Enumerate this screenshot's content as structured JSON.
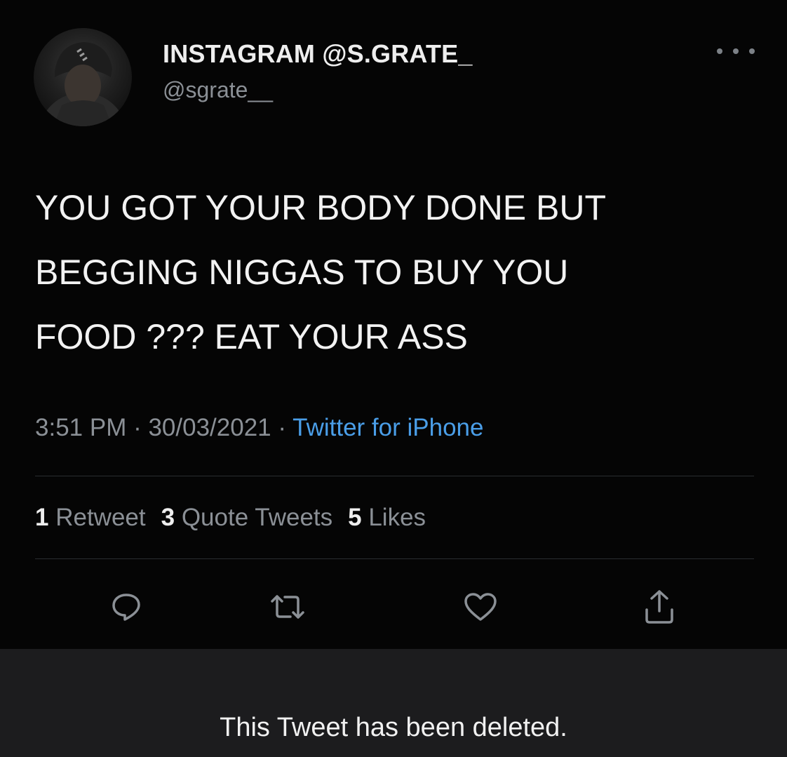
{
  "tweet": {
    "display_name": "INSTAGRAM @S.GRATE_",
    "handle": "@sgrate__",
    "more_icon": "ellipsis-icon",
    "text": "YOU GOT YOUR BODY DONE BUT\nBEGGING NIGGAS TO BUY YOU\nFOOD ??? EAT YOUR ASS",
    "time": "3:51 PM",
    "date": "30/03/2021",
    "separator": " · ",
    "source": "Twitter for iPhone",
    "stats": {
      "retweets_count": "1",
      "retweets_label": "Retweet",
      "quotes_count": "3",
      "quotes_label": "Quote Tweets",
      "likes_count": "5",
      "likes_label": "Likes"
    },
    "actions": [
      "reply-icon",
      "retweet-icon",
      "like-icon",
      "share-icon"
    ]
  },
  "notice": {
    "text": "This Tweet has been deleted."
  },
  "colors": {
    "background": "#000000",
    "link": "#4a9ee8",
    "secondary_text": "#8b9096",
    "notice_background": "#1c1c1e"
  }
}
